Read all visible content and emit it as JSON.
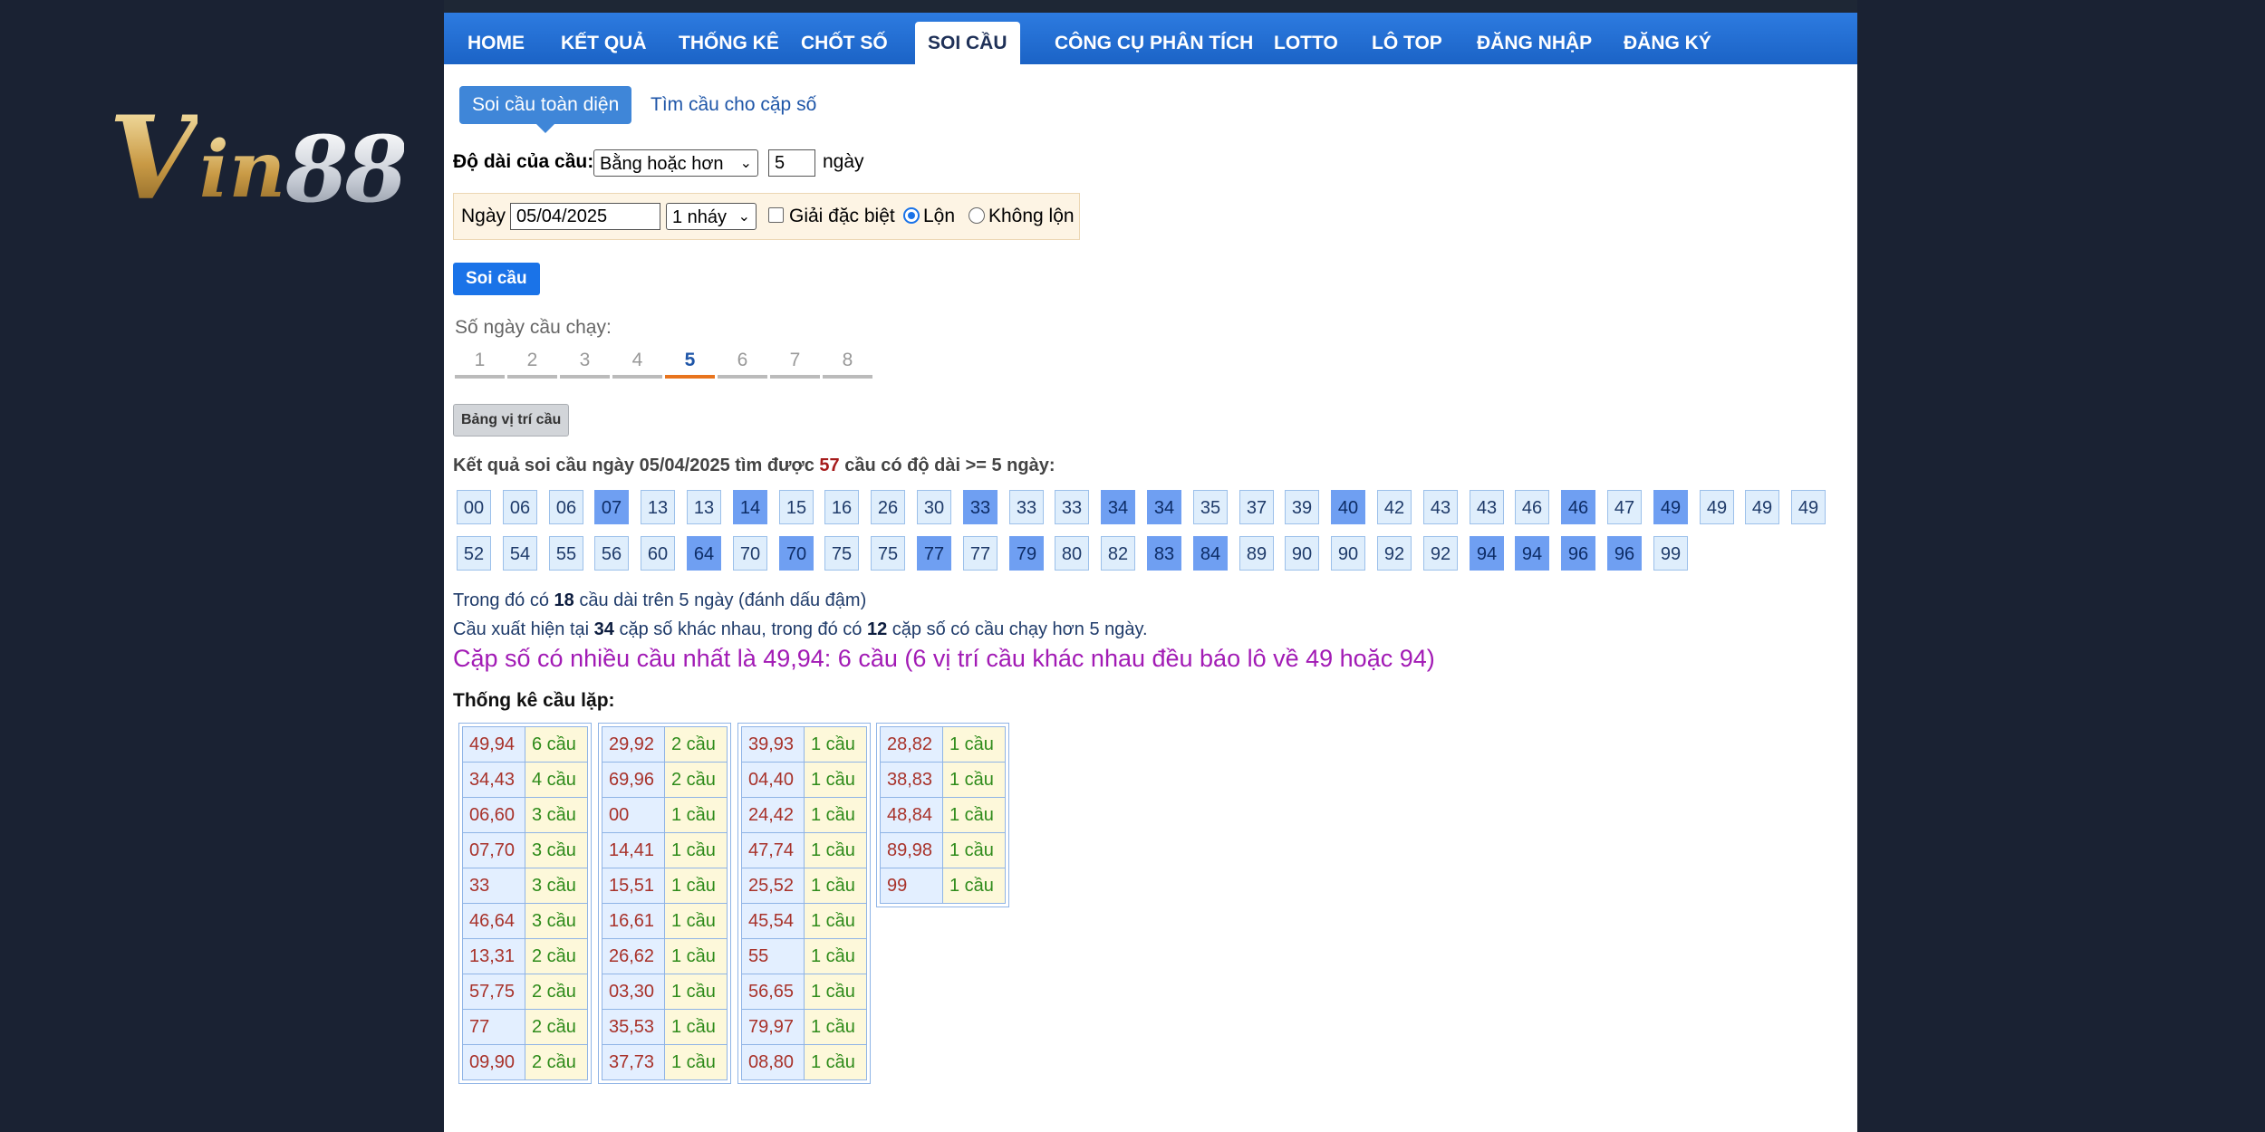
{
  "logo": {
    "text_v": "V",
    "text_in": "in",
    "text_num": "88"
  },
  "nav": {
    "items": [
      "HOME",
      "KẾT QUẢ",
      "THỐNG KÊ",
      "CHỐT SỐ",
      "SOI CẦU",
      "CÔNG CỤ PHÂN TÍCH",
      "LOTTO",
      "LÔ TOP",
      "ĐĂNG NHẬP",
      "ĐĂNG KÝ"
    ],
    "active": "SOI CẦU"
  },
  "subtabs": {
    "active": "Soi cầu toàn diện",
    "other": "Tìm cầu cho cặp số"
  },
  "length": {
    "label": "Độ dài của cầu:",
    "select_value": "Bằng hoặc hơn",
    "input_value": "5",
    "unit": "ngày"
  },
  "filter": {
    "date_label": "Ngày",
    "date_value": "05/04/2025",
    "nhay_value": "1 nháy",
    "gdb_label": "Giải đặc biệt",
    "gdb_checked": false,
    "lon_label": "Lộn",
    "lon_selected": true,
    "khonglon_label": "Không lộn"
  },
  "soi_button": "Soi cầu",
  "days": {
    "label": "Số ngày cầu chạy:",
    "items": [
      "1",
      "2",
      "3",
      "4",
      "5",
      "6",
      "7",
      "8"
    ],
    "active": "5"
  },
  "bang_button": "Bảng vị trí cầu",
  "result": {
    "prefix": "Kết quả soi cầu ngày 05/04/2025 tìm được ",
    "count": "57",
    "suffix": " cầu có độ dài >= 5 ngày:"
  },
  "chips": [
    {
      "v": "00",
      "h": false
    },
    {
      "v": "06",
      "h": false
    },
    {
      "v": "06",
      "h": false
    },
    {
      "v": "07",
      "h": true
    },
    {
      "v": "13",
      "h": false
    },
    {
      "v": "13",
      "h": false
    },
    {
      "v": "14",
      "h": true
    },
    {
      "v": "15",
      "h": false
    },
    {
      "v": "16",
      "h": false
    },
    {
      "v": "26",
      "h": false
    },
    {
      "v": "30",
      "h": false
    },
    {
      "v": "33",
      "h": true
    },
    {
      "v": "33",
      "h": false
    },
    {
      "v": "33",
      "h": false
    },
    {
      "v": "34",
      "h": true
    },
    {
      "v": "34",
      "h": true
    },
    {
      "v": "35",
      "h": false
    },
    {
      "v": "37",
      "h": false
    },
    {
      "v": "39",
      "h": false
    },
    {
      "v": "40",
      "h": true
    },
    {
      "v": "42",
      "h": false
    },
    {
      "v": "43",
      "h": false
    },
    {
      "v": "43",
      "h": false
    },
    {
      "v": "46",
      "h": false
    },
    {
      "v": "46",
      "h": true
    },
    {
      "v": "47",
      "h": false
    },
    {
      "v": "49",
      "h": true
    },
    {
      "v": "49",
      "h": false
    },
    {
      "v": "49",
      "h": false
    },
    {
      "v": "49",
      "h": false
    },
    {
      "v": "52",
      "h": false
    },
    {
      "v": "54",
      "h": false
    },
    {
      "v": "55",
      "h": false
    },
    {
      "v": "56",
      "h": false
    },
    {
      "v": "60",
      "h": false
    },
    {
      "v": "64",
      "h": true
    },
    {
      "v": "70",
      "h": false
    },
    {
      "v": "70",
      "h": true
    },
    {
      "v": "75",
      "h": false
    },
    {
      "v": "75",
      "h": false
    },
    {
      "v": "77",
      "h": true
    },
    {
      "v": "77",
      "h": false
    },
    {
      "v": "79",
      "h": true
    },
    {
      "v": "80",
      "h": false
    },
    {
      "v": "82",
      "h": false
    },
    {
      "v": "83",
      "h": true
    },
    {
      "v": "84",
      "h": true
    },
    {
      "v": "89",
      "h": false
    },
    {
      "v": "90",
      "h": false
    },
    {
      "v": "90",
      "h": false
    },
    {
      "v": "92",
      "h": false
    },
    {
      "v": "92",
      "h": false
    },
    {
      "v": "94",
      "h": true
    },
    {
      "v": "94",
      "h": true
    },
    {
      "v": "96",
      "h": true
    },
    {
      "v": "96",
      "h": true
    },
    {
      "v": "99",
      "h": false
    }
  ],
  "info1": {
    "a": "Trong đó có ",
    "b": "18",
    "c": " cầu dài trên 5 ngày (đánh dấu đậm)"
  },
  "info2": {
    "a": "Cầu xuất hiện tại ",
    "b": "34",
    "c": " cặp số khác nhau, trong đó có ",
    "d": "12",
    "e": " cặp số có cầu chạy hơn 5 ngày."
  },
  "headline": "Cặp số có nhiều cầu nhất là 49,94: 6 cầu (6 vị trí cầu khác nhau đều báo lô về 49 hoặc 94)",
  "stats_title": "Thống kê cầu lặp:",
  "stats_tables": [
    [
      [
        "49,94",
        "6 cầu"
      ],
      [
        "34,43",
        "4 cầu"
      ],
      [
        "06,60",
        "3 cầu"
      ],
      [
        "07,70",
        "3 cầu"
      ],
      [
        "33",
        "3 cầu"
      ],
      [
        "46,64",
        "3 cầu"
      ],
      [
        "13,31",
        "2 cầu"
      ],
      [
        "57,75",
        "2 cầu"
      ],
      [
        "77",
        "2 cầu"
      ],
      [
        "09,90",
        "2 cầu"
      ]
    ],
    [
      [
        "29,92",
        "2 cầu"
      ],
      [
        "69,96",
        "2 cầu"
      ],
      [
        "00",
        "1 cầu"
      ],
      [
        "14,41",
        "1 cầu"
      ],
      [
        "15,51",
        "1 cầu"
      ],
      [
        "16,61",
        "1 cầu"
      ],
      [
        "26,62",
        "1 cầu"
      ],
      [
        "03,30",
        "1 cầu"
      ],
      [
        "35,53",
        "1 cầu"
      ],
      [
        "37,73",
        "1 cầu"
      ]
    ],
    [
      [
        "39,93",
        "1 cầu"
      ],
      [
        "04,40",
        "1 cầu"
      ],
      [
        "24,42",
        "1 cầu"
      ],
      [
        "47,74",
        "1 cầu"
      ],
      [
        "25,52",
        "1 cầu"
      ],
      [
        "45,54",
        "1 cầu"
      ],
      [
        "55",
        "1 cầu"
      ],
      [
        "56,65",
        "1 cầu"
      ],
      [
        "79,97",
        "1 cầu"
      ],
      [
        "08,80",
        "1 cầu"
      ]
    ],
    [
      [
        "28,82",
        "1 cầu"
      ],
      [
        "38,83",
        "1 cầu"
      ],
      [
        "48,84",
        "1 cầu"
      ],
      [
        "89,98",
        "1 cầu"
      ],
      [
        "99",
        "1 cầu"
      ]
    ]
  ]
}
